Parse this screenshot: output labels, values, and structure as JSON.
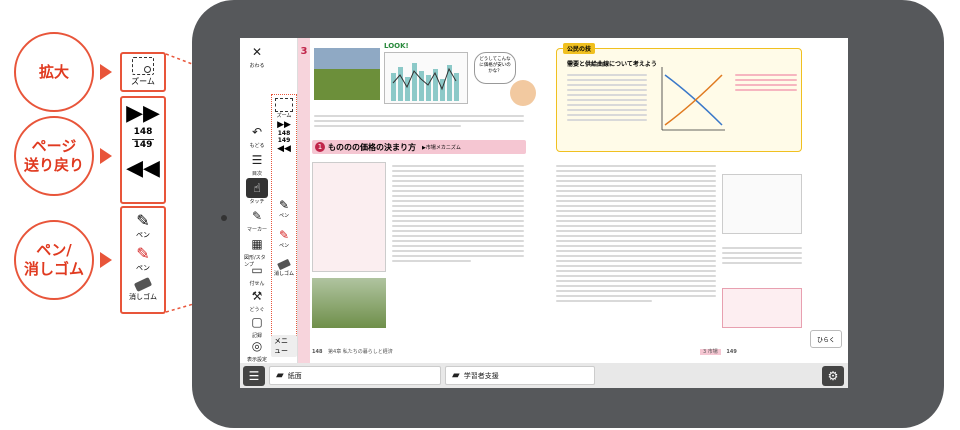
{
  "callouts": {
    "zoom": "拡大",
    "page_nav": "ページ\n送り戻り",
    "pen_eraser": "ペン/\n消しゴム"
  },
  "zoom_panel": {
    "zoom_label": "ズーム",
    "page_top": "148",
    "page_bottom": "149",
    "pen_black_label": "ペン",
    "pen_red_label": "ペン",
    "eraser_label": "消しゴム"
  },
  "toolbar": {
    "close_label": "おわる",
    "zoom_label": "ズーム",
    "back_label": "もどる",
    "toc_label": "目次",
    "page_top": "148",
    "page_bottom": "149",
    "pointer_label": "タッチ",
    "pen_label": "ペン",
    "marker_label": "マーカー",
    "pen2_label": "ペン",
    "stamp_label": "図形/スタンプ",
    "eraser_label": "消しゴム",
    "fusen_label": "付せん",
    "tools_label": "どうぐ",
    "record_label": "記録",
    "display_label": "表示設定",
    "menu_label": "メニュー"
  },
  "page_left": {
    "chapter_num": "3",
    "section_title": "もののの価格の決まり方",
    "section_num": "1",
    "section_sub": "▶市場メカニズム",
    "look": "LOOK!",
    "bubble": "どうしてこんなに価格が安いのかな？",
    "footer_page": "148",
    "footer_text": "第4章 私たちの暮らしと経済"
  },
  "page_right": {
    "box_title": "公民の技",
    "box_sub": "需要と供給曲線について考えよう",
    "footer_page": "149",
    "footer_tag": "3 市場"
  },
  "bottombar": {
    "tab1": "紙面",
    "tab2": "学習者支援",
    "open_label": "ひらく"
  }
}
